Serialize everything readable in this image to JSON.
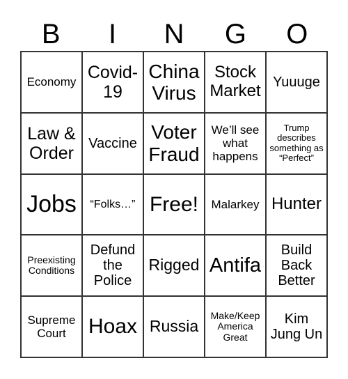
{
  "header": [
    "B",
    "I",
    "N",
    "G",
    "O"
  ],
  "cells": [
    {
      "text": "Economy",
      "size": 17
    },
    {
      "text": "Covid-19",
      "size": 25
    },
    {
      "text": "China Virus",
      "size": 28
    },
    {
      "text": "Stock Market",
      "size": 24
    },
    {
      "text": "Yuuuge",
      "size": 20
    },
    {
      "text": "Law & Order",
      "size": 25
    },
    {
      "text": "Vaccine",
      "size": 20
    },
    {
      "text": "Voter Fraud",
      "size": 28
    },
    {
      "text": "We’ll see what happens",
      "size": 17
    },
    {
      "text": "Trump describes something as “Perfect”",
      "size": 13
    },
    {
      "text": "Jobs",
      "size": 34
    },
    {
      "text": "“Folks…”",
      "size": 16
    },
    {
      "text": "Free!",
      "size": 30
    },
    {
      "text": "Malarkey",
      "size": 17
    },
    {
      "text": "Hunter",
      "size": 24
    },
    {
      "text": "Preexisting Conditions",
      "size": 14
    },
    {
      "text": "Defund the Police",
      "size": 20
    },
    {
      "text": "Rigged",
      "size": 23
    },
    {
      "text": "Antifa",
      "size": 29
    },
    {
      "text": "Build Back Better",
      "size": 20
    },
    {
      "text": "Supreme Court",
      "size": 17
    },
    {
      "text": "Hoax",
      "size": 30
    },
    {
      "text": "Russia",
      "size": 23
    },
    {
      "text": "Make/Keep America Great",
      "size": 14
    },
    {
      "text": "Kim Jung Un",
      "size": 20
    }
  ]
}
